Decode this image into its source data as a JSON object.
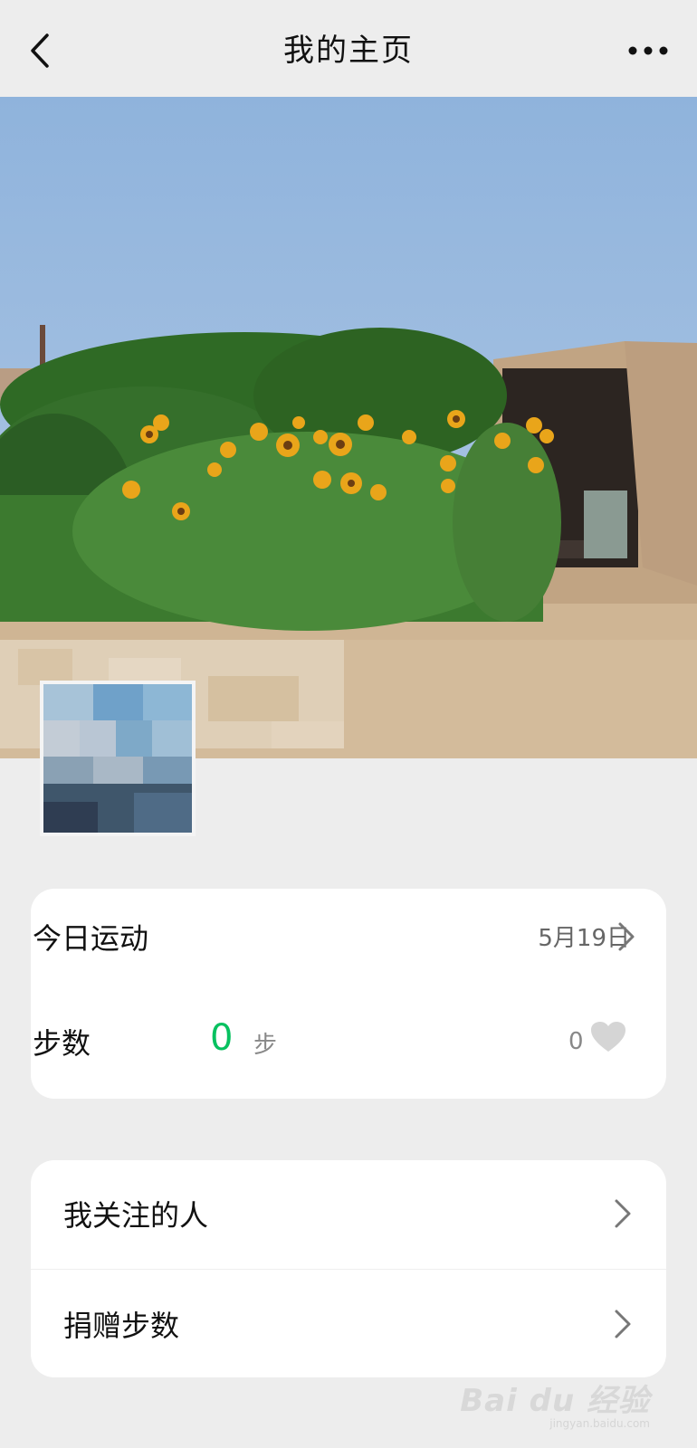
{
  "navbar": {
    "title": "我的主页",
    "back_icon": "chevron-left-icon",
    "more_icon": "more-dots-icon"
  },
  "cover": {
    "description_icon": "cover-photo"
  },
  "sport_card": {
    "title": "今日运动",
    "date": "5月19日",
    "steps_label": "步数",
    "steps_value": "0",
    "steps_unit": "步",
    "likes_count": "0",
    "accent_color": "#07c160"
  },
  "menu": {
    "items": [
      {
        "label": "我关注的人"
      },
      {
        "label": "捐赠步数"
      }
    ]
  },
  "watermark": {
    "text": "Bai du 经验",
    "sub": "jingyan.baidu.com"
  }
}
